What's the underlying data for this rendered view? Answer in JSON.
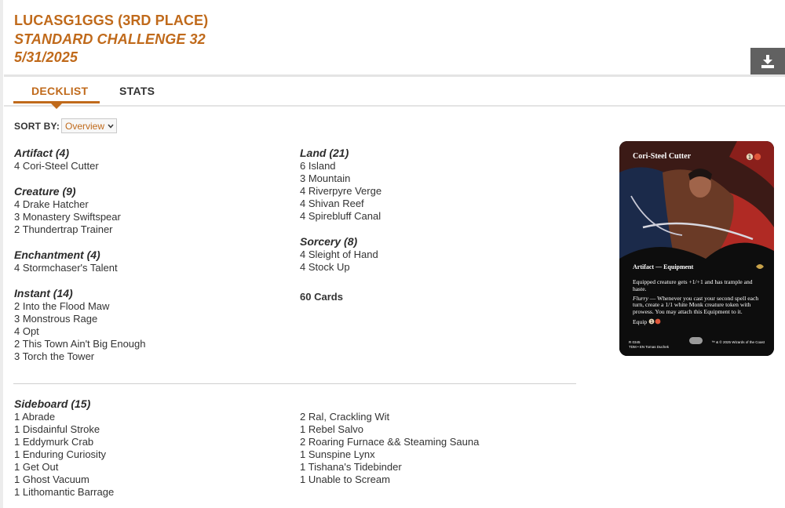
{
  "header": {
    "player": "LUCASG1GGS (3RD PLACE)",
    "event": "STANDARD CHALLENGE 32",
    "date": "5/31/2025",
    "download_icon": "download-icon"
  },
  "tabs": [
    {
      "label": "DECKLIST",
      "active": true
    },
    {
      "label": "STATS",
      "active": false
    }
  ],
  "sort": {
    "label": "SORT BY:",
    "selected": "Overview"
  },
  "decklist": {
    "column_1": [
      {
        "title": "Artifact (4)",
        "cards": [
          "4 Cori-Steel Cutter"
        ]
      },
      {
        "title": "Creature (9)",
        "cards": [
          "4 Drake Hatcher",
          "3 Monastery Swiftspear",
          "2 Thundertrap Trainer"
        ]
      },
      {
        "title": "Enchantment (4)",
        "cards": [
          "4 Stormchaser's Talent"
        ]
      },
      {
        "title": "Instant (14)",
        "cards": [
          "2 Into the Flood Maw",
          "3 Monstrous Rage",
          "4 Opt",
          "2 This Town Ain't Big Enough",
          "3 Torch the Tower"
        ]
      }
    ],
    "column_2": [
      {
        "title": "Land (21)",
        "cards": [
          "6 Island",
          "3 Mountain",
          "4 Riverpyre Verge",
          "4 Shivan Reef",
          "4 Spirebluff Canal"
        ]
      },
      {
        "title": "Sorcery (8)",
        "cards": [
          "4 Sleight of Hand",
          "4 Stock Up"
        ]
      }
    ],
    "total": "60 Cards"
  },
  "sideboard": {
    "title": "Sideboard (15)",
    "column_1": [
      "1 Abrade",
      "1 Disdainful Stroke",
      "1 Eddymurk Crab",
      "1 Enduring Curiosity",
      "1 Get Out",
      "1 Ghost Vacuum",
      "1 Lithomantic Barrage"
    ],
    "column_2": [
      "2 Ral, Crackling Wit",
      "1 Rebel Salvo",
      "2 Roaring Furnace && Steaming Sauna",
      "1 Sunspine Lynx",
      "1 Tishana's Tidebinder",
      "1 Unable to Scream"
    ]
  },
  "card_preview": {
    "name": "Cori-Steel Cutter",
    "type_line": "Artifact — Equipment",
    "rules_1": "Equipped creature gets +1/+1 and has trample and haste.",
    "flurry_label": "Flurry",
    "rules_2": " — Whenever you cast your second spell each turn, create a 1/1 white Monk creature token with prowess. You may attach this Equipment to it.",
    "equip": "Equip",
    "collector_line_1": "R 0345",
    "collector_line_2": "TDM • EN",
    "artist": "Tomas Duchek",
    "copyright": "™ & © 2025 Wizards of the Coast",
    "colors": {
      "red_mana": "#e0573a",
      "mana_symbol_bg": "#e8d6b8"
    }
  }
}
